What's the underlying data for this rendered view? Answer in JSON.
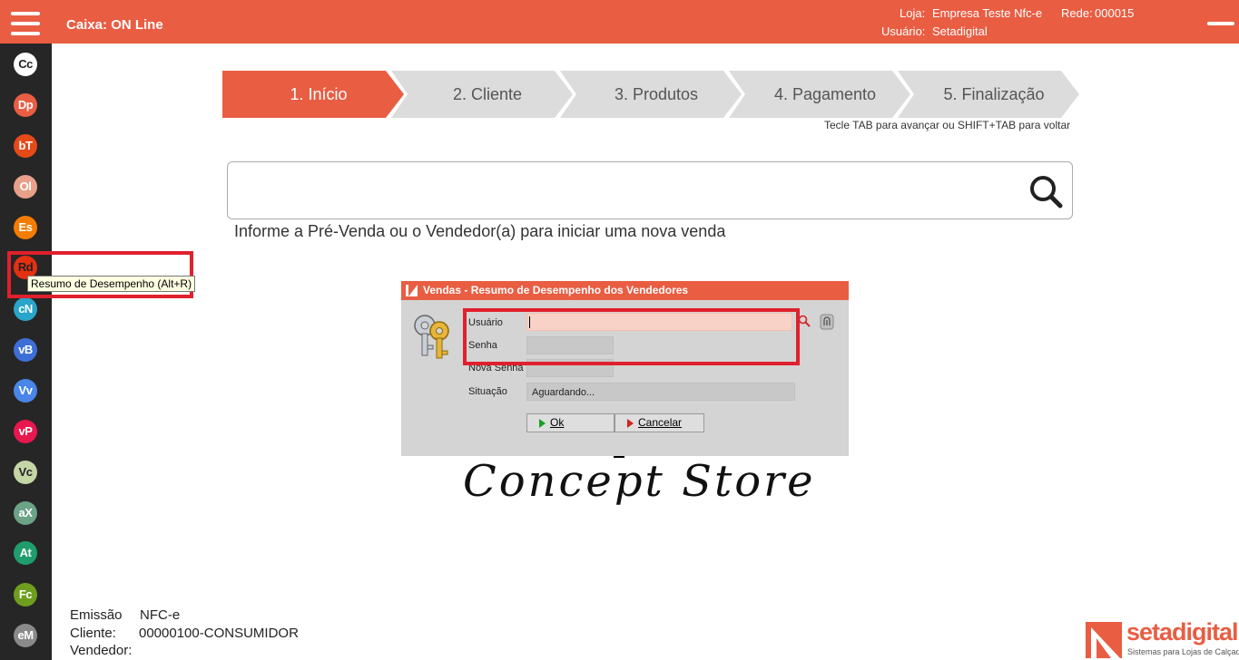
{
  "header": {
    "title": "Caixa: ON Line",
    "loja_label": "Loja:",
    "loja_value": "Empresa Teste Nfc-e",
    "rede_label": "Rede:",
    "rede_value": "000015",
    "usuario_label": "Usuário:",
    "usuario_value": "Setadigital"
  },
  "sidebar": {
    "items": [
      {
        "label": "Cc",
        "color": "#ffffff",
        "text": "#222222"
      },
      {
        "label": "Dp",
        "color": "#e95d43",
        "text": "#ffffff"
      },
      {
        "label": "bT",
        "color": "#e64a19",
        "text": "#ffffff"
      },
      {
        "label": "Ol",
        "color": "#e8a08a",
        "text": "#ffffff"
      },
      {
        "label": "Es",
        "color": "#f57c00",
        "text": "#ffffff"
      },
      {
        "label": "Rd",
        "color": "#e53012",
        "text": "#222222"
      },
      {
        "label": "cN",
        "color": "#29a5c9",
        "text": "#ffffff"
      },
      {
        "label": "vB",
        "color": "#3d6fd6",
        "text": "#ffffff"
      },
      {
        "label": "Vv",
        "color": "#4a86e8",
        "text": "#ffffff"
      },
      {
        "label": "vP",
        "color": "#e8174e",
        "text": "#ffffff"
      },
      {
        "label": "Vc",
        "color": "#c5d6a6",
        "text": "#222222"
      },
      {
        "label": "aX",
        "color": "#6aa386",
        "text": "#ffffff"
      },
      {
        "label": "At",
        "color": "#1f9d6c",
        "text": "#ffffff"
      },
      {
        "label": "Fc",
        "color": "#6e9e1e",
        "text": "#ffffff"
      },
      {
        "label": "eM",
        "color": "#8a8a8a",
        "text": "#ffffff"
      }
    ],
    "tooltip": "Resumo de Desempenho (Alt+R)"
  },
  "steps": [
    {
      "label": "1. Início"
    },
    {
      "label": "2. Cliente"
    },
    {
      "label": "3. Produtos"
    },
    {
      "label": "4. Pagamento"
    },
    {
      "label": "5. Finalização"
    }
  ],
  "hint": "Tecle TAB para avançar ou SHIFT+TAB para voltar",
  "search": {
    "value": "",
    "placeholder": ""
  },
  "info_text": "Informe a Pré-Venda ou o Vendedor(a) para iniciar uma nova venda",
  "dialog": {
    "title": "Vendas - Resumo de Desempenho dos Vendedores",
    "usuario_label": "Usuário",
    "usuario_value": "",
    "senha_label": "Senha",
    "nova_senha_label": "Nova Senha",
    "situacao_label": "Situação",
    "situacao_value": "Aguardando...",
    "ok_label": "Ok",
    "cancel_label": "Cancelar"
  },
  "footer": {
    "emissao_label": "Emissão",
    "emissao_value": "NFC-e",
    "cliente_label": "Cliente:",
    "cliente_value": "00000100-CONSUMIDOR",
    "vendedor_label": "Vendedor:",
    "vendedor_value": ""
  },
  "brand": {
    "name": "setadigital",
    "tagline": "Sistemas para Lojas de Calçados"
  },
  "logo_text": "Concept Store",
  "colors": {
    "accent": "#e95d43",
    "sidebar_bg": "#262626",
    "highlight": "#e0202c"
  }
}
